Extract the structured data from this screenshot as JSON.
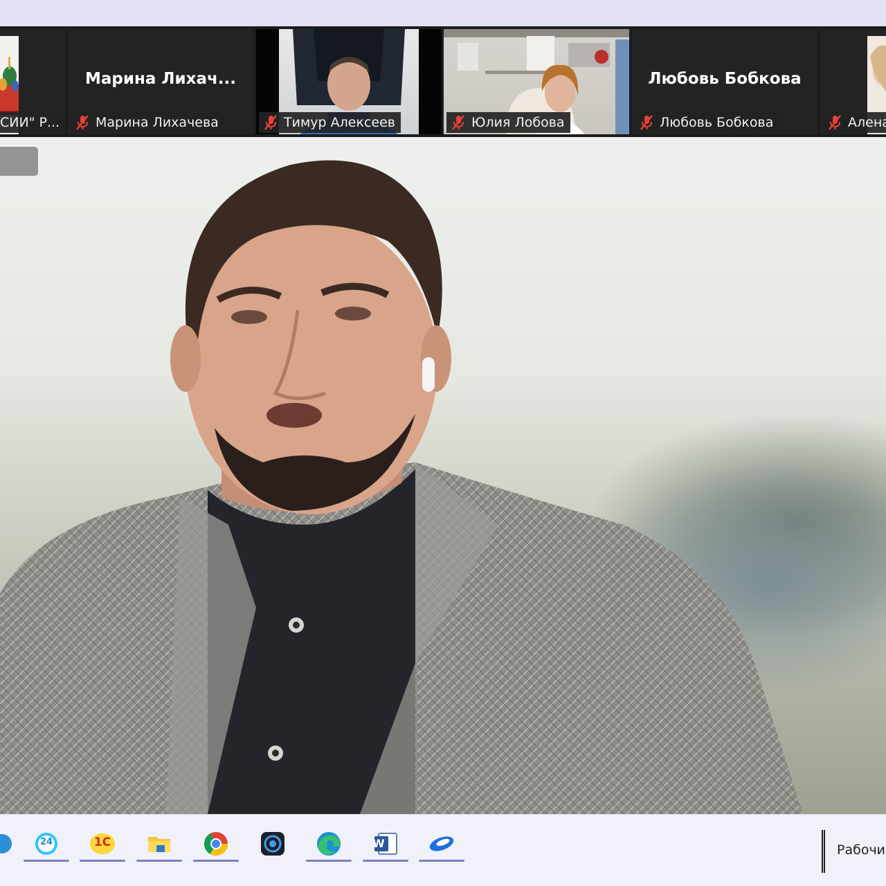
{
  "gallery": {
    "participants": [
      {
        "big_name": "",
        "plate": "СИИ\" Р...",
        "muted": false
      },
      {
        "big_name": "Марина  Лихач...",
        "plate": "Марина Лихачева",
        "muted": true
      },
      {
        "big_name": "",
        "plate": "Тимур Алексеев",
        "muted": true
      },
      {
        "big_name": "",
        "plate": "Юлия Лобова",
        "muted": true
      },
      {
        "big_name": "Любовь Бобкова",
        "plate": "Любовь Бобкова",
        "muted": true
      },
      {
        "big_name": "",
        "plate": "Алена",
        "muted": true
      }
    ]
  },
  "taskbar": {
    "apps": [
      {
        "icon": "blue-circle-icon"
      },
      {
        "icon": "bitrix24-icon",
        "label": "24"
      },
      {
        "icon": "1c-icon",
        "label": "1С"
      },
      {
        "icon": "file-explorer-icon"
      },
      {
        "icon": "chrome-icon"
      },
      {
        "icon": "camera-app-icon"
      },
      {
        "icon": "edge-icon"
      },
      {
        "icon": "word-icon",
        "label": "W"
      },
      {
        "icon": "zoom-app-icon"
      }
    ],
    "tray_text": "Рабочи"
  },
  "colors": {
    "muted_mic": "#e8403a",
    "indicator": "#7d7fc4",
    "top_strip": "#e4e0f6"
  }
}
